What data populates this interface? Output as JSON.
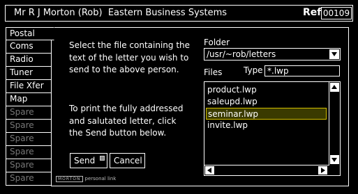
{
  "header": {
    "title": "Mr R J Morton (Rob)  Eastern Business Systems",
    "ref_label": "Ref",
    "ref_value": "00109"
  },
  "tabs": [
    {
      "label": "Postal",
      "state": "active"
    },
    {
      "label": "Coms",
      "state": "normal"
    },
    {
      "label": "Radio",
      "state": "normal"
    },
    {
      "label": "Tuner",
      "state": "normal"
    },
    {
      "label": "File Xfer",
      "state": "normal"
    },
    {
      "label": "Map",
      "state": "normal"
    },
    {
      "label": "Spare",
      "state": "disabled"
    },
    {
      "label": "Spare",
      "state": "disabled"
    },
    {
      "label": "Spare",
      "state": "disabled"
    },
    {
      "label": "Spare",
      "state": "disabled"
    },
    {
      "label": "Spare",
      "state": "disabled"
    },
    {
      "label": "Spare",
      "state": "disabled"
    }
  ],
  "main": {
    "instructions_1": "Select the file containing the text of the letter you wish to send to the above person.",
    "instructions_2": "To print the fully addressed and salutated letter, click the Send button below.",
    "send_label": "Send",
    "cancel_label": "Cancel",
    "brand_logo": "MORTON",
    "brand_text": "personal link"
  },
  "folder": {
    "label": "Folder",
    "value": "/usr/~rob/letters"
  },
  "files": {
    "label": "Files",
    "type_label": "Type",
    "type_value": "*.lwp",
    "items": [
      "product.lwp",
      "saleupd.lwp",
      "seminar.lwp",
      "invite.lwp"
    ],
    "selected_index": 2
  },
  "colors": {
    "background": "#000000",
    "foreground": "#ffffff",
    "selection_border": "#d4c000",
    "disabled_text": "#777777"
  }
}
